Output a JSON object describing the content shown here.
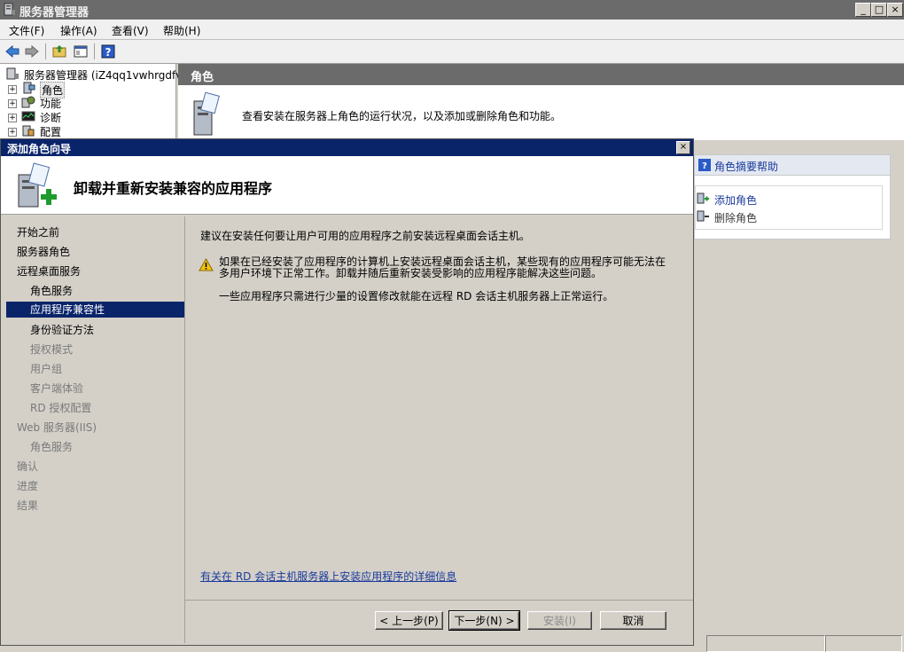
{
  "window": {
    "title": "服务器管理器",
    "controls": {
      "minimize": "_",
      "maximize": "□",
      "close": "×"
    }
  },
  "menu": [
    {
      "label": "文件(F)"
    },
    {
      "label": "操作(A)"
    },
    {
      "label": "查看(V)"
    },
    {
      "label": "帮助(H)"
    }
  ],
  "tree": {
    "root": "服务器管理器 (iZ4qq1vwhrgdfv",
    "items": [
      {
        "label": "角色",
        "icon": "roles-icon"
      },
      {
        "label": "功能",
        "icon": "features-icon"
      },
      {
        "label": "诊断",
        "icon": "diagnostics-icon"
      },
      {
        "label": "配置",
        "icon": "configuration-icon"
      }
    ],
    "expander": "+"
  },
  "roles_pane": {
    "header": "角色",
    "description": "查看安装在服务器上角色的运行状况，以及添加或删除角色和功能。",
    "help_link": "角色摘要帮助",
    "actions": [
      {
        "label": "添加角色",
        "icon": "add-role-icon"
      },
      {
        "label": "删除角色",
        "icon": "remove-role-icon"
      }
    ]
  },
  "wizard": {
    "title": "添加角色向导",
    "close": "×",
    "heading": "卸载并重新安装兼容的应用程序",
    "steps": [
      {
        "label": "开始之前",
        "state": "normal",
        "indent": 0
      },
      {
        "label": "服务器角色",
        "state": "normal",
        "indent": 0
      },
      {
        "label": "远程桌面服务",
        "state": "normal",
        "indent": 0
      },
      {
        "label": "角色服务",
        "state": "normal",
        "indent": 1
      },
      {
        "label": "应用程序兼容性",
        "state": "selected",
        "indent": 1
      },
      {
        "label": "身份验证方法",
        "state": "normal",
        "indent": 1
      },
      {
        "label": "授权模式",
        "state": "disabled",
        "indent": 1
      },
      {
        "label": "用户组",
        "state": "disabled",
        "indent": 1
      },
      {
        "label": "客户端体验",
        "state": "disabled",
        "indent": 1
      },
      {
        "label": "RD 授权配置",
        "state": "disabled",
        "indent": 1
      },
      {
        "label": "Web 服务器(IIS)",
        "state": "disabled",
        "indent": 0
      },
      {
        "label": "角色服务",
        "state": "disabled",
        "indent": 1
      },
      {
        "label": "确认",
        "state": "disabled",
        "indent": 0
      },
      {
        "label": "进度",
        "state": "disabled",
        "indent": 0
      },
      {
        "label": "结果",
        "state": "disabled",
        "indent": 0
      }
    ],
    "intro": "建议在安装任何要让用户可用的应用程序之前安装远程桌面会话主机。",
    "warning_line1": "如果在已经安装了应用程序的计算机上安装远程桌面会话主机，某些现有的应用程序可能无法在",
    "warning_line2": "多用户环境下正常工作。卸载并随后重新安装受影响的应用程序能解决这些问题。",
    "note": "一些应用程序只需进行少量的设置修改就能在远程 RD 会话主机服务器上正常运行。",
    "more_link": "有关在 RD 会话主机服务器上安装应用程序的详细信息",
    "buttons": {
      "prev": "< 上一步(P)",
      "next": "下一步(N) >",
      "install": "安装(I)",
      "cancel": "取消"
    }
  },
  "colors": {
    "dialog_title_bg": "#0a246a",
    "window_title_bg": "#6b6b6b",
    "link": "#1a3a9c"
  }
}
